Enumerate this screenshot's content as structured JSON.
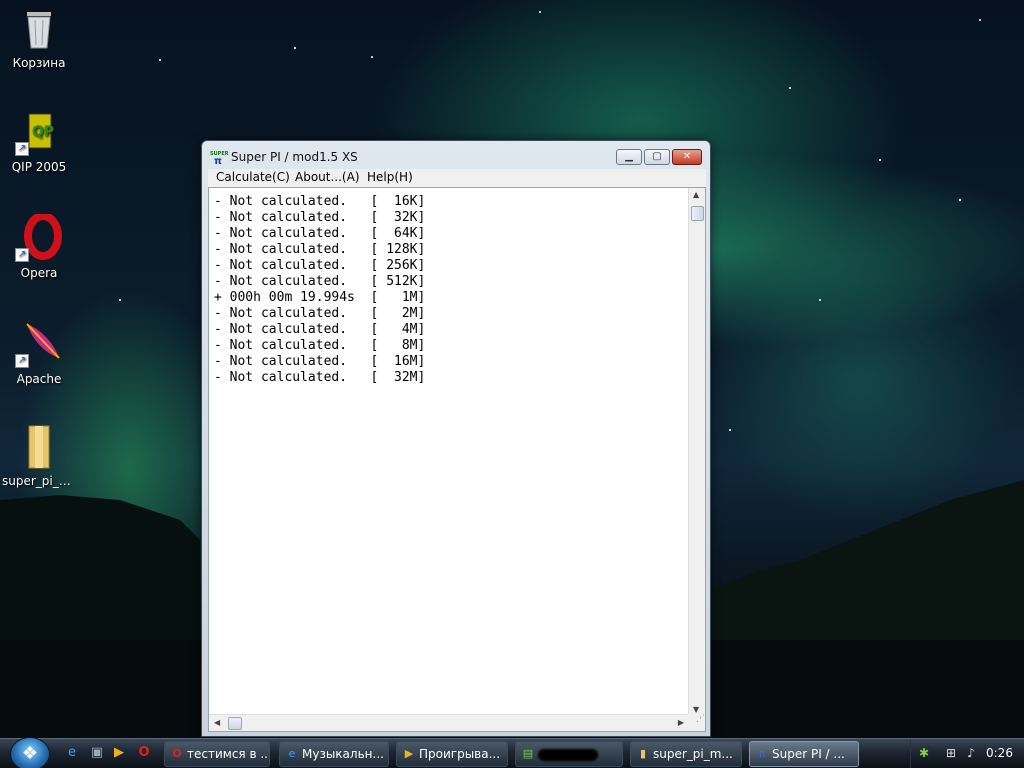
{
  "desktop": {
    "icons": [
      {
        "label": "Корзина",
        "icon": "recycle-bin-icon"
      },
      {
        "label": "QIP 2005",
        "icon": "qip-icon"
      },
      {
        "label": "Opera",
        "icon": "opera-icon"
      },
      {
        "label": "Apache",
        "icon": "apache-feather-icon"
      },
      {
        "label": "super_pi_m...",
        "icon": "folder-icon"
      }
    ]
  },
  "window": {
    "title": "Super PI / mod1.5 XS",
    "app_icon_text": "SUPER",
    "menu": [
      "Calculate(C)",
      "About...(A)",
      "Help(H)"
    ],
    "results": [
      {
        "status": "- Not calculated.  ",
        "size": "[  16K]"
      },
      {
        "status": "- Not calculated.  ",
        "size": "[  32K]"
      },
      {
        "status": "- Not calculated.  ",
        "size": "[  64K]"
      },
      {
        "status": "- Not calculated.  ",
        "size": "[ 128K]"
      },
      {
        "status": "- Not calculated.  ",
        "size": "[ 256K]"
      },
      {
        "status": "- Not calculated.  ",
        "size": "[ 512K]"
      },
      {
        "status": "+ 000h 00m 19.994s ",
        "size": "[   1M]"
      },
      {
        "status": "- Not calculated.  ",
        "size": "[   2M]"
      },
      {
        "status": "- Not calculated.  ",
        "size": "[   4M]"
      },
      {
        "status": "- Not calculated.  ",
        "size": "[   8M]"
      },
      {
        "status": "- Not calculated.  ",
        "size": "[  16M]"
      },
      {
        "status": "- Not calculated.  ",
        "size": "[  32M]"
      }
    ]
  },
  "taskbar": {
    "quick_launch": [
      "ie-icon",
      "show-desktop-icon",
      "media-player-icon",
      "opera-icon"
    ],
    "tasks": [
      {
        "label": "тестимся в ...",
        "icon": "opera-icon",
        "active": false
      },
      {
        "label": "Музыкальн...",
        "icon": "ie-icon",
        "active": false
      },
      {
        "label": "Проигрыва...",
        "icon": "media-player-icon",
        "active": false
      },
      {
        "label": "",
        "icon": "app-icon",
        "active": false,
        "redacted": true
      },
      {
        "label": "super_pi_m...",
        "icon": "folder-icon",
        "active": false
      },
      {
        "label": "Super PI / ...",
        "icon": "superpi-icon",
        "active": true
      }
    ],
    "clock": "0:26"
  }
}
